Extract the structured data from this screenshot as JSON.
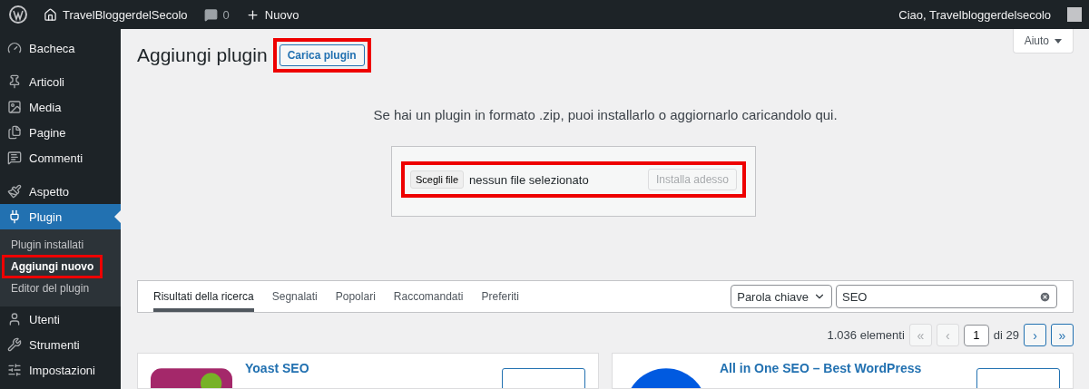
{
  "admin_bar": {
    "site_name": "TravelBloggerdelSecolo",
    "comments_count": "0",
    "new_label": "Nuovo",
    "greeting": "Ciao, Travelbloggerdelsecolo"
  },
  "sidebar": {
    "groups": [
      {
        "items": [
          {
            "label": "Bacheca",
            "selected": false
          }
        ]
      },
      {
        "items": [
          {
            "label": "Articoli",
            "selected": false
          },
          {
            "label": "Media",
            "selected": false
          },
          {
            "label": "Pagine",
            "selected": false
          },
          {
            "label": "Commenti",
            "selected": false
          }
        ]
      },
      {
        "items": [
          {
            "label": "Aspetto",
            "selected": false
          },
          {
            "label": "Plugin",
            "selected": true,
            "children": [
              {
                "label": "Plugin installati",
                "selected": false,
                "highlighted": false
              },
              {
                "label": "Aggiungi nuovo",
                "selected": true,
                "highlighted": true
              },
              {
                "label": "Editor del plugin",
                "selected": false,
                "highlighted": false
              }
            ]
          },
          {
            "label": "Utenti",
            "selected": false
          },
          {
            "label": "Strumenti",
            "selected": false
          },
          {
            "label": "Impostazioni",
            "selected": false
          }
        ]
      }
    ]
  },
  "help_button": "Aiuto",
  "page": {
    "title": "Aggiungi plugin",
    "upload_button": {
      "label": "Carica plugin",
      "highlighted": true
    }
  },
  "upload": {
    "intro": "Se hai un plugin in formato .zip, puoi installarlo o aggiornarlo caricandolo qui.",
    "choose_button": "Scegli file",
    "file_status": "nessun file selezionato",
    "install_button": {
      "label": "Installa adesso",
      "disabled": true
    },
    "highlighted": true
  },
  "filter": {
    "tabs": [
      {
        "label": "Risultati della ricerca",
        "selected": true
      },
      {
        "label": "Segnalati",
        "selected": false
      },
      {
        "label": "Popolari",
        "selected": false
      },
      {
        "label": "Raccomandati",
        "selected": false
      },
      {
        "label": "Preferiti",
        "selected": false
      }
    ],
    "search_type": "Parola chiave",
    "search_value": "SEO"
  },
  "pagination": {
    "count": "1.036 elementi",
    "first": {
      "label": "«",
      "disabled": true
    },
    "prev": {
      "label": "‹",
      "disabled": true
    },
    "page": "1",
    "total": "di 29",
    "next": {
      "label": "›",
      "disabled": false
    },
    "last": {
      "label": "»",
      "disabled": false
    }
  },
  "plugins": [
    {
      "name": "Yoast SEO",
      "kind": "yoast"
    },
    {
      "name": "All in One SEO – Best WordPress",
      "kind": "aioseo"
    }
  ]
}
